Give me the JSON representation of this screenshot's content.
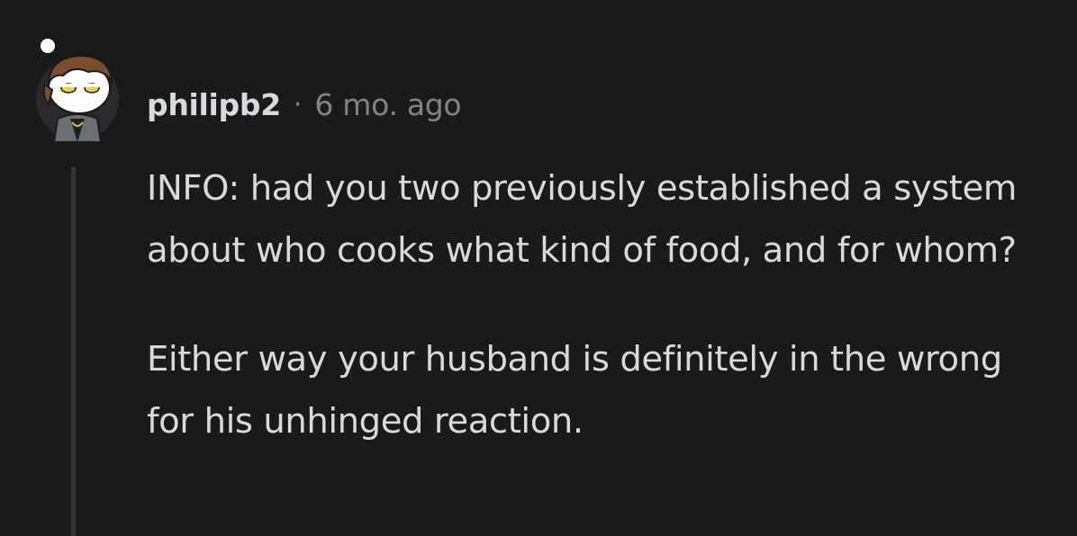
{
  "comment": {
    "author": "philipb2",
    "separator": "·",
    "time_ago": "6 mo. ago",
    "paragraphs": [
      "INFO: had you two previously established a system about who cooks what kind of food, and for whom?",
      "Either way your husband is definitely in the wrong for his unhinged reaction."
    ]
  },
  "avatar": {
    "icon": "snoo-avatar-icon",
    "colors": {
      "background": "#2a2a2b",
      "hair": "#7a4e2d",
      "face": "#ffffff",
      "eyes": "#f2d233",
      "jacket": "#6b6e72"
    }
  },
  "colors": {
    "background": "#1a1a1b",
    "text": "#d7dadc",
    "meta": "#818384",
    "thread_line": "#343536"
  }
}
